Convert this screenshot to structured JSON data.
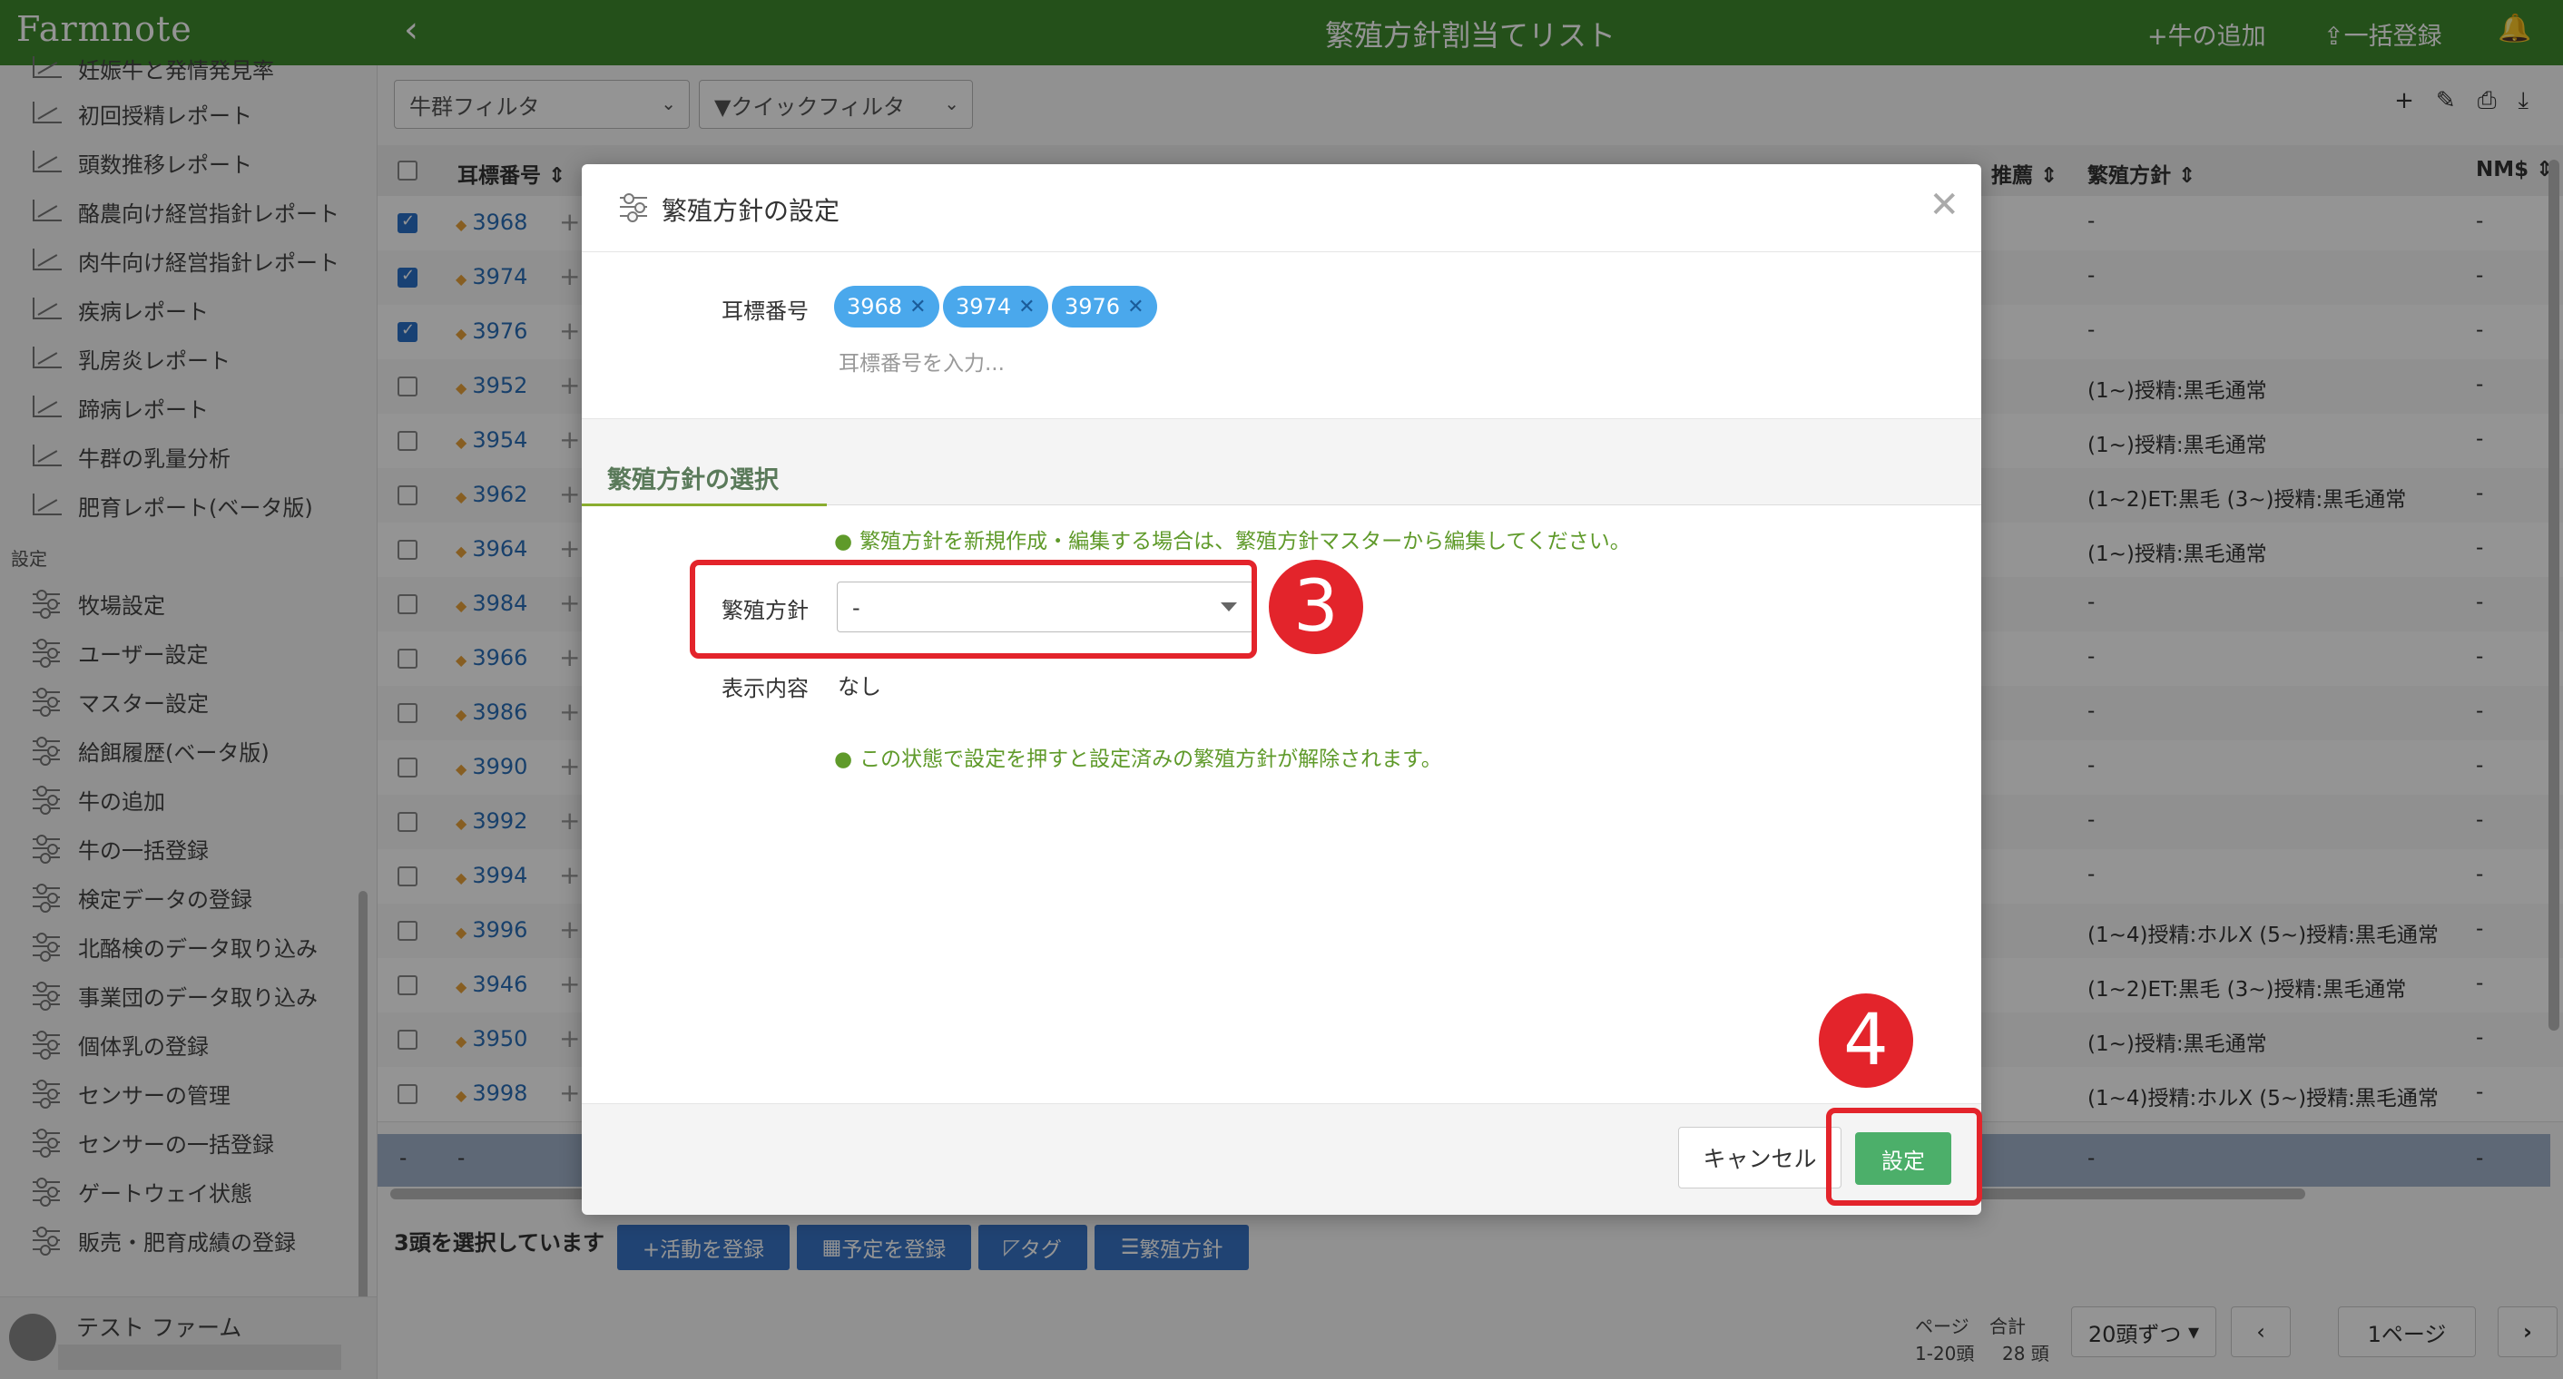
{
  "app": {
    "logo": "Farmnote",
    "page_title": "繁殖方針割当てリスト",
    "back_icon": "chevron-left-icon"
  },
  "top_actions": {
    "add_cow": "+牛の追加",
    "bulk_register": "一括登録",
    "bell_icon": "bell-icon"
  },
  "sidebar": {
    "report_items": [
      "妊娠牛と発情発見率",
      "初回授精レポート",
      "頭数推移レポート",
      "酪農向け経営指針レポート",
      "肉牛向け経営指針レポート",
      "疾病レポート",
      "乳房炎レポート",
      "蹄病レポート",
      "牛群の乳量分析",
      "肥育レポート(ベータ版)"
    ],
    "section_label": "設定",
    "setting_items": [
      "牧場設定",
      "ユーザー設定",
      "マスター設定",
      "給餌履歴(ベータ版)",
      "牛の追加",
      "牛の一括登録",
      "検定データの登録",
      "北酪検のデータ取り込み",
      "事業団のデータ取り込み",
      "個体乳の登録",
      "センサーの管理",
      "センサーの一括登録",
      "ゲートウェイ状態",
      "販売・肥育成績の登録"
    ],
    "farm_name": "テスト ファーム"
  },
  "filters": {
    "herd": "牛群フィルタ",
    "quick": "▼クイックフィルタ"
  },
  "table": {
    "headers": {
      "ear_tag": "耳標番号",
      "recommend": "推薦",
      "plan": "繁殖方針",
      "nm": "NM$"
    },
    "rows": [
      {
        "tag": "3968",
        "checked": true,
        "plan": "-",
        "nm": "-"
      },
      {
        "tag": "3974",
        "checked": true,
        "plan": "-",
        "nm": "-"
      },
      {
        "tag": "3976",
        "checked": true,
        "plan": "-",
        "nm": "-"
      },
      {
        "tag": "3952",
        "checked": false,
        "plan": "(1~)授精:黒毛通常",
        "nm": "-"
      },
      {
        "tag": "3954",
        "checked": false,
        "plan": "(1~)授精:黒毛通常",
        "nm": "-"
      },
      {
        "tag": "3962",
        "checked": false,
        "plan": "(1~2)ET:黒毛 (3~)授精:黒毛通常",
        "nm": "-"
      },
      {
        "tag": "3964",
        "checked": false,
        "plan": "(1~)授精:黒毛通常",
        "nm": "-"
      },
      {
        "tag": "3984",
        "checked": false,
        "plan": "-",
        "nm": "-"
      },
      {
        "tag": "3966",
        "checked": false,
        "plan": "-",
        "nm": "-"
      },
      {
        "tag": "3986",
        "checked": false,
        "plan": "-",
        "nm": "-"
      },
      {
        "tag": "3990",
        "checked": false,
        "plan": "-",
        "nm": "-"
      },
      {
        "tag": "3992",
        "checked": false,
        "plan": "-",
        "nm": "-"
      },
      {
        "tag": "3994",
        "checked": false,
        "plan": "-",
        "nm": "-"
      },
      {
        "tag": "3996",
        "checked": false,
        "plan": "(1~4)授精:ホルX (5~)授精:黒毛通常",
        "nm": "-"
      },
      {
        "tag": "3946",
        "checked": false,
        "plan": "(1~2)ET:黒毛 (3~)授精:黒毛通常",
        "nm": "-"
      },
      {
        "tag": "3950",
        "checked": false,
        "plan": "(1~)授精:黒毛通常",
        "nm": "-"
      },
      {
        "tag": "3998",
        "checked": false,
        "plan": "(1~4)授精:ホルX (5~)授精:黒毛通常",
        "nm": "-"
      }
    ],
    "summary_row": {
      "c1": "-",
      "c2": "-",
      "plan": "-",
      "nm": "-"
    }
  },
  "selection": {
    "text": "3頭を選択しています",
    "buttons": [
      "+活動を登録",
      "予定を登録",
      "タグ",
      "繁殖方針"
    ]
  },
  "pagination": {
    "page_label": "ページ",
    "total_label": "合計",
    "range": "1-20頭",
    "total": "28 頭",
    "per_page": "20頭ずつ",
    "current": "1ページ"
  },
  "modal": {
    "title": "繁殖方針の設定",
    "ear_tag_label": "耳標番号",
    "chips": [
      "3968",
      "3974",
      "3976"
    ],
    "tag_placeholder": "耳標番号を入力...",
    "section_tab": "繁殖方針の選択",
    "info_top": "繁殖方針を新規作成・編集する場合は、繁殖方針マスターから編集してください。",
    "plan_label": "繁殖方針",
    "plan_value": "-",
    "display_label": "表示内容",
    "display_value": "なし",
    "info_bottom": "この状態で設定を押すと設定済みの繁殖方針が解除されます。",
    "cancel": "キャンセル",
    "submit": "設定"
  },
  "annotations": {
    "step3": "3",
    "step4": "4",
    "color": "#e3242b"
  }
}
